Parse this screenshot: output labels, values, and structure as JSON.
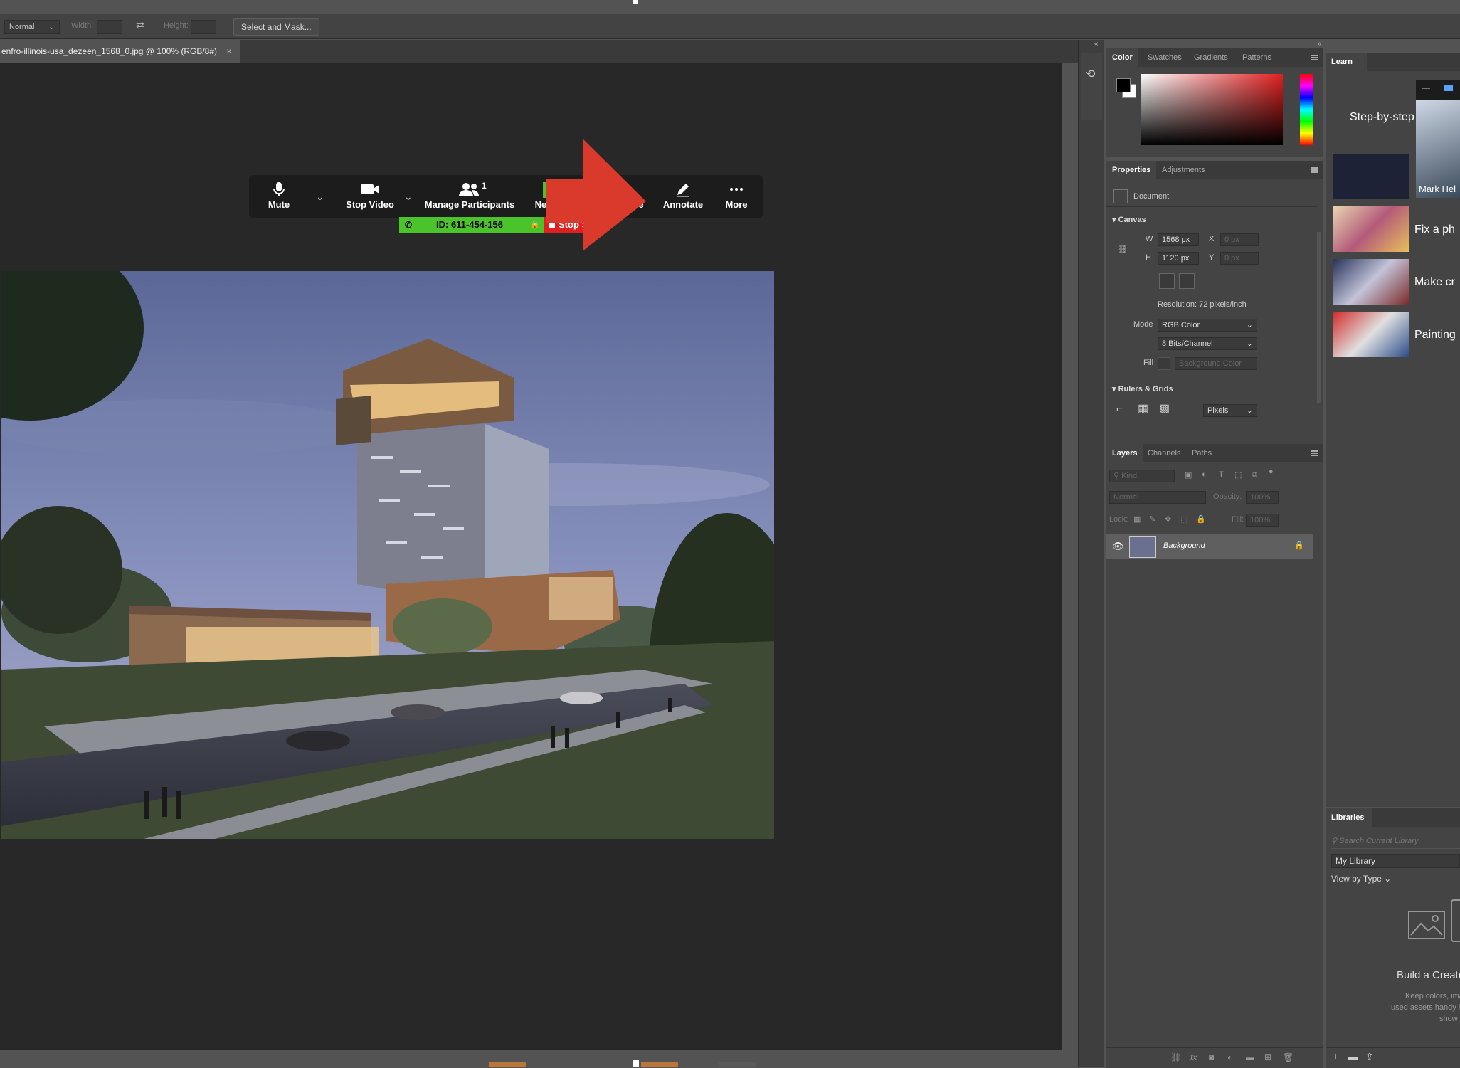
{
  "options_bar": {
    "style_value": "Normal",
    "width_label": "Width:",
    "height_label": "Height:",
    "select_mask_button": "Select and Mask..."
  },
  "document": {
    "tab_title": "enfro-illinois-usa_dezeen_1568_0.jpg @ 100% (RGB/8#)",
    "close": "×"
  },
  "zoom_toolbar": {
    "mute": "Mute",
    "stop_video": "Stop Video",
    "participants_count": "1",
    "manage_participants": "Manage Participants",
    "new_share_partial": "New",
    "share_partial": "e",
    "annotate": "Annotate",
    "more": "More",
    "meeting_id": "ID: 611-454-156",
    "stop_share_partial": "Stop S"
  },
  "color_panel": {
    "tabs": [
      "Color",
      "Swatches",
      "Gradients",
      "Patterns"
    ]
  },
  "properties_panel": {
    "tabs": [
      "Properties",
      "Adjustments"
    ],
    "document_label": "Document",
    "canvas_section": "Canvas",
    "w_label": "W",
    "w_value": "1568 px",
    "x_label": "X",
    "x_value": "0 px",
    "h_label": "H",
    "h_value": "1120 px",
    "y_label": "Y",
    "y_value": "0 px",
    "resolution": "Resolution: 72 pixels/inch",
    "mode_label": "Mode",
    "mode_value": "RGB Color",
    "bits_value": "8 Bits/Channel",
    "fill_label": "Fill",
    "fill_value": "Background Color",
    "rulers_section": "Rulers & Grids",
    "units_value": "Pixels"
  },
  "layers_panel": {
    "tabs": [
      "Layers",
      "Channels",
      "Paths"
    ],
    "kind_placeholder": "Kind",
    "blend_mode": "Normal",
    "opacity_label": "Opacity:",
    "opacity_value": "100%",
    "lock_label": "Lock:",
    "fill_label": "Fill:",
    "fill_value": "100%",
    "layer_name": "Background"
  },
  "learn_panel": {
    "tab": "Learn",
    "heading": "Step-by-step t",
    "popup_name": "Mark Hel",
    "items": [
      "Fix a ph",
      "Make cr",
      "Painting"
    ]
  },
  "libraries_panel": {
    "tab": "Libraries",
    "search_placeholder": "Search Current Library",
    "library_select": "My Library",
    "view_by": "View by Type",
    "build_title": "Build a Creati",
    "desc_line1": "Keep colors, image",
    "desc_line2": "used assets handy i",
    "desc_line3": "show"
  },
  "colors": {
    "zoom_green": "#4bc32a",
    "zoom_red": "#e02020",
    "annotation_arrow": "#d93a2b"
  }
}
